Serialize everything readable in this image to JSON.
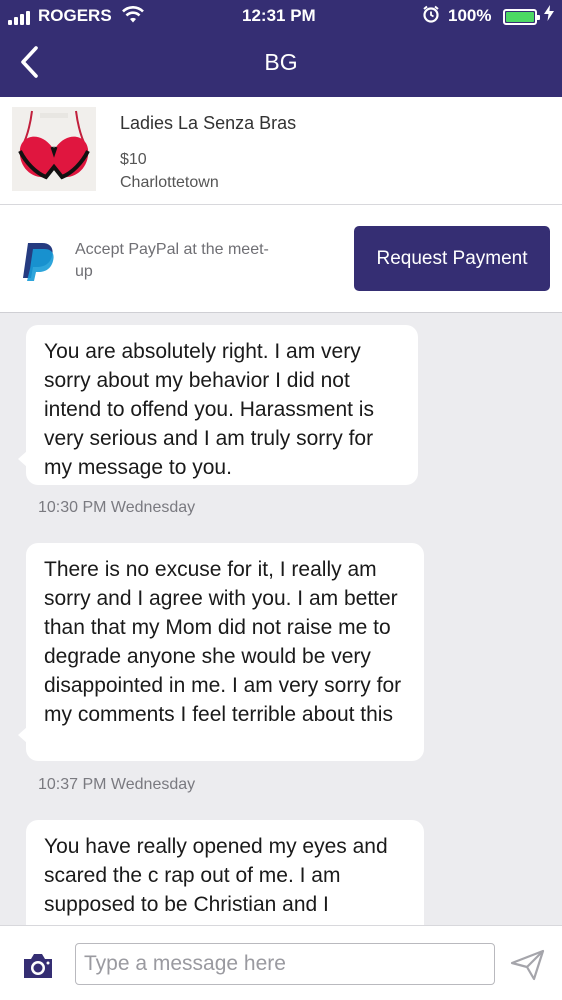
{
  "status_bar": {
    "carrier": "ROGERS",
    "time": "12:31 PM",
    "battery": "100%",
    "icons": [
      "signal-icon",
      "wifi-icon",
      "alarm-icon",
      "battery-icon",
      "charging-icon"
    ]
  },
  "nav": {
    "title": "BG",
    "back_icon": "chevron-left-icon"
  },
  "listing": {
    "title": "Ladies La Senza Bras",
    "price": "$10",
    "location": "Charlottetown"
  },
  "payment": {
    "text": "Accept PayPal at the meet-up",
    "button_label": "Request Payment",
    "icon": "paypal-icon"
  },
  "messages": [
    {
      "text": "You are absolutely right. I am very sorry about my behavior I did not intend to offend you. Harassment is very serious and I am truly sorry for my message to you.",
      "time": "10:30 PM Wednesday"
    },
    {
      "text": "There is no excuse for it, I really am sorry and I agree with you. I am better than that my Mom did not raise me to degrade anyone she would be very disappointed in me. I am very sorry for my comments I feel terrible about this",
      "time": "10:37 PM Wednesday"
    },
    {
      "text": "You have really opened my eyes and scared the c rap out of me. I am supposed to be Christian and I"
    }
  ],
  "composer": {
    "placeholder": "Type a message here",
    "value": "",
    "camera_icon": "camera-icon",
    "send_icon": "send-icon"
  },
  "colors": {
    "brand": "#352e73",
    "background": "#ececef",
    "bubble": "#ffffff",
    "battery": "#4cd964"
  }
}
